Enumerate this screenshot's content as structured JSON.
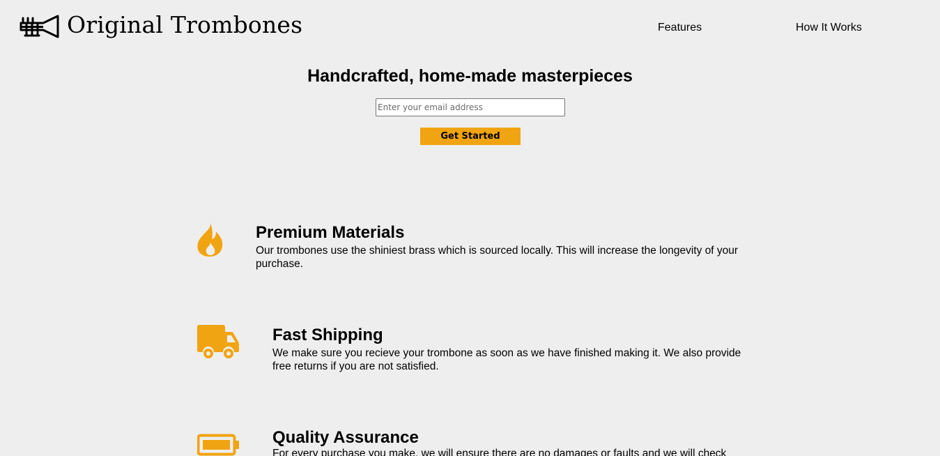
{
  "header": {
    "logo_text": "Original Trombones",
    "nav": [
      {
        "label": "Features"
      },
      {
        "label": "How It Works"
      }
    ]
  },
  "hero": {
    "title": "Handcrafted, home-made masterpieces",
    "email_placeholder": "Enter your email address",
    "email_value": "",
    "cta_label": "Get Started"
  },
  "features": [
    {
      "icon": "fire-icon",
      "title": "Premium Materials",
      "description": "Our trombones use the shiniest brass which is sourced locally. This will increase the longevity of your purchase."
    },
    {
      "icon": "truck-icon",
      "title": "Fast Shipping",
      "description": "We make sure you recieve your trombone as soon as we have finished making it. We also provide free returns if you are not satisfied."
    },
    {
      "icon": "battery-icon",
      "title": "Quality Assurance",
      "description": "For every purchase you make, we will ensure there are no damages or faults and we will check"
    }
  ],
  "colors": {
    "accent": "#f1a411",
    "background": "#eeeeee",
    "text": "#000000"
  }
}
